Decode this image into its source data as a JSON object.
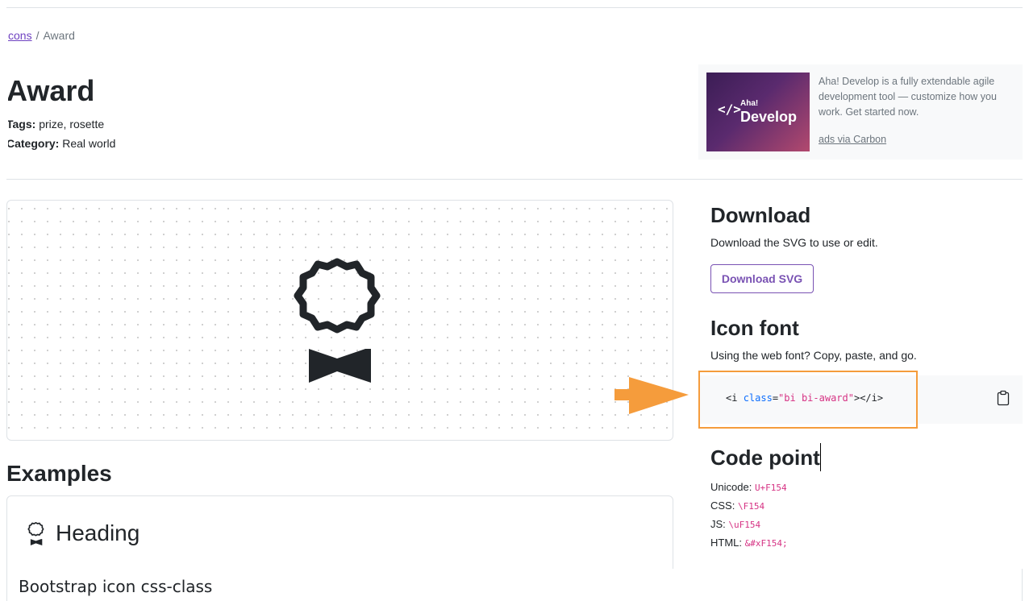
{
  "breadcrumb": {
    "parent": "cons",
    "separator": "/",
    "current": "Award"
  },
  "page": {
    "title": "Award",
    "tags_label": "Tags:",
    "tags_value": "prize, rosette",
    "category_label": "Category:",
    "category_value": "Real world"
  },
  "ad": {
    "image_code_glyph": "</>",
    "image_aha": "Aha!",
    "image_develop": "Develop",
    "text": "Aha! Develop is a fully extendable agile development tool — customize how you work. Get started now.",
    "link": "ads via Carbon"
  },
  "download": {
    "title": "Download",
    "description": "Download the SVG to use or edit.",
    "button": "Download SVG"
  },
  "icon_font": {
    "title": "Icon font",
    "description": "Using the web font? Copy, paste, and go.",
    "code_open": "<i ",
    "code_attr": "class",
    "code_eq": "=",
    "code_str": "\"bi bi-award\"",
    "code_close": "></i>"
  },
  "code_point": {
    "title": "Code point",
    "unicode_label": "Unicode:",
    "unicode_value": "U+F154",
    "css_label": "CSS:",
    "css_value": "\\F154",
    "js_label": "JS:",
    "js_value": "\\uF154",
    "html_label": "HTML:",
    "html_value": "&#xF154;"
  },
  "examples": {
    "title": "Examples",
    "heading": "Heading"
  },
  "caption": "Bootstrap icon css-class",
  "colors": {
    "accent": "#7952b3",
    "highlight": "#f59c3c",
    "code_string": "#d63384",
    "code_attr": "#0d6efd"
  },
  "icons": [
    "award-icon",
    "clipboard-icon",
    "arrow-right-icon"
  ]
}
